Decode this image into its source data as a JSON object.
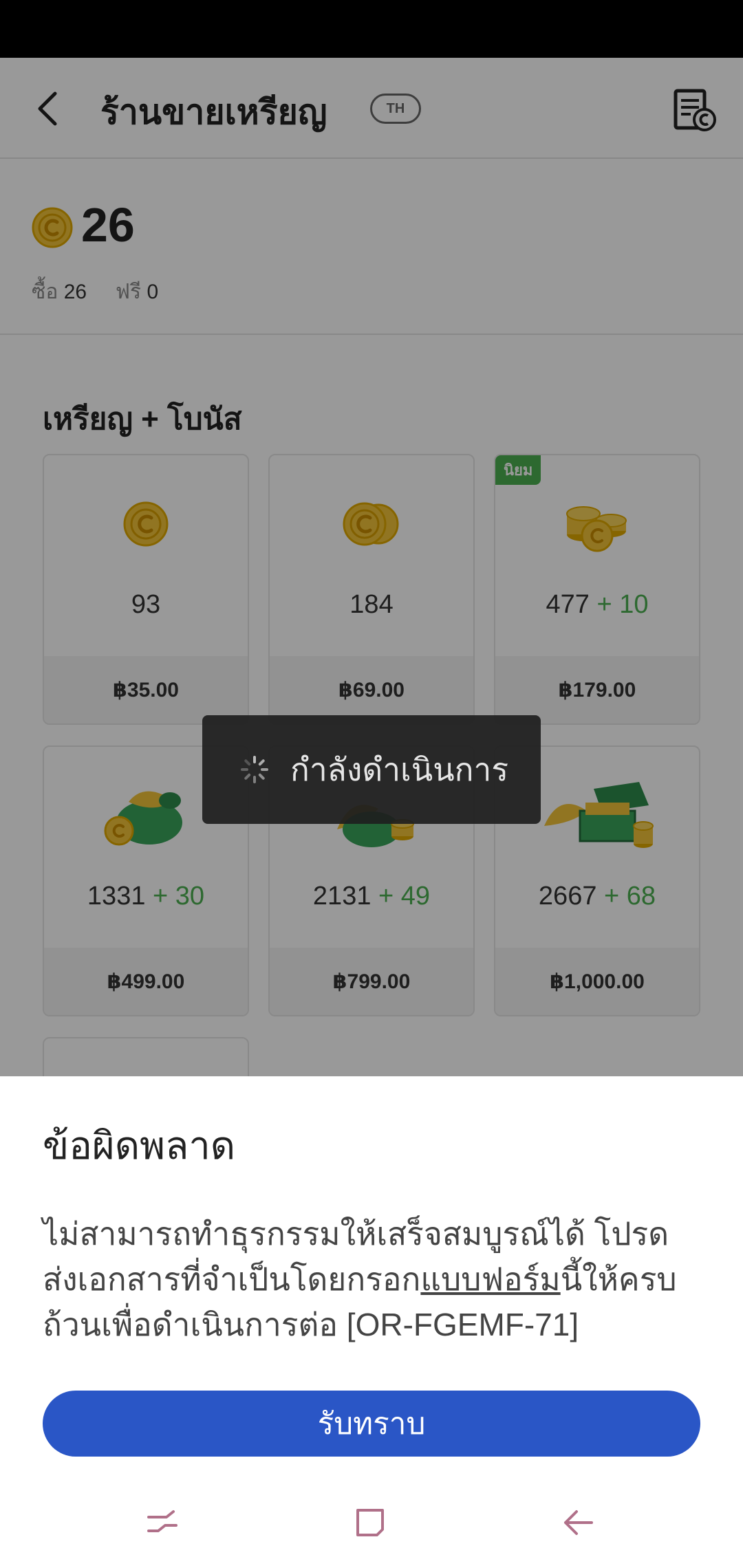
{
  "header": {
    "title": "ร้านขายเหรียญ",
    "lang_badge": "TH"
  },
  "balance": {
    "value": "26",
    "bought_label": "ซื้อ",
    "bought_value": "26",
    "free_label": "ฟรี",
    "free_value": "0"
  },
  "section": {
    "title": "เหรียญ + โบนัส"
  },
  "packages": [
    {
      "amount": "93",
      "bonus": "",
      "price": "฿35.00"
    },
    {
      "amount": "184",
      "bonus": "",
      "price": "฿69.00"
    },
    {
      "amount": "477",
      "bonus": "+ 10",
      "price": "฿179.00",
      "tag": "นิยม"
    },
    {
      "amount": "1331",
      "bonus": "+ 30",
      "price": "฿499.00"
    },
    {
      "amount": "2131",
      "bonus": "+ 49",
      "price": "฿799.00"
    },
    {
      "amount": "2667",
      "bonus": "+ 68",
      "price": "฿1,000.00"
    }
  ],
  "toast": {
    "text": "กำลังดำเนินการ"
  },
  "dialog": {
    "title": "ข้อผิดพลาด",
    "body_part1": "ไม่สามารถทำธุรกรรมให้เสร็จสมบูรณ์ได้ โปรดส่งเอกสารที่จำเป็นโดยกรอก",
    "link_text": "แบบฟอร์ม",
    "body_part2": "นี้ให้ครบถ้วนเพื่อดำเนินการต่อ [OR-FGEMF-71]",
    "button_label": "รับทราบ"
  },
  "icons": {
    "back": "chevron-left-icon",
    "history": "coin-history-icon",
    "coin": "coin-icon",
    "spinner": "loading-spinner-icon",
    "nav_recent": "recent-apps-icon",
    "nav_home": "home-icon",
    "nav_back": "back-arrow-icon"
  },
  "colors": {
    "primary_button": "#2a56c6",
    "bonus_green": "#4caf50",
    "coin_gold": "#f2c43a"
  }
}
